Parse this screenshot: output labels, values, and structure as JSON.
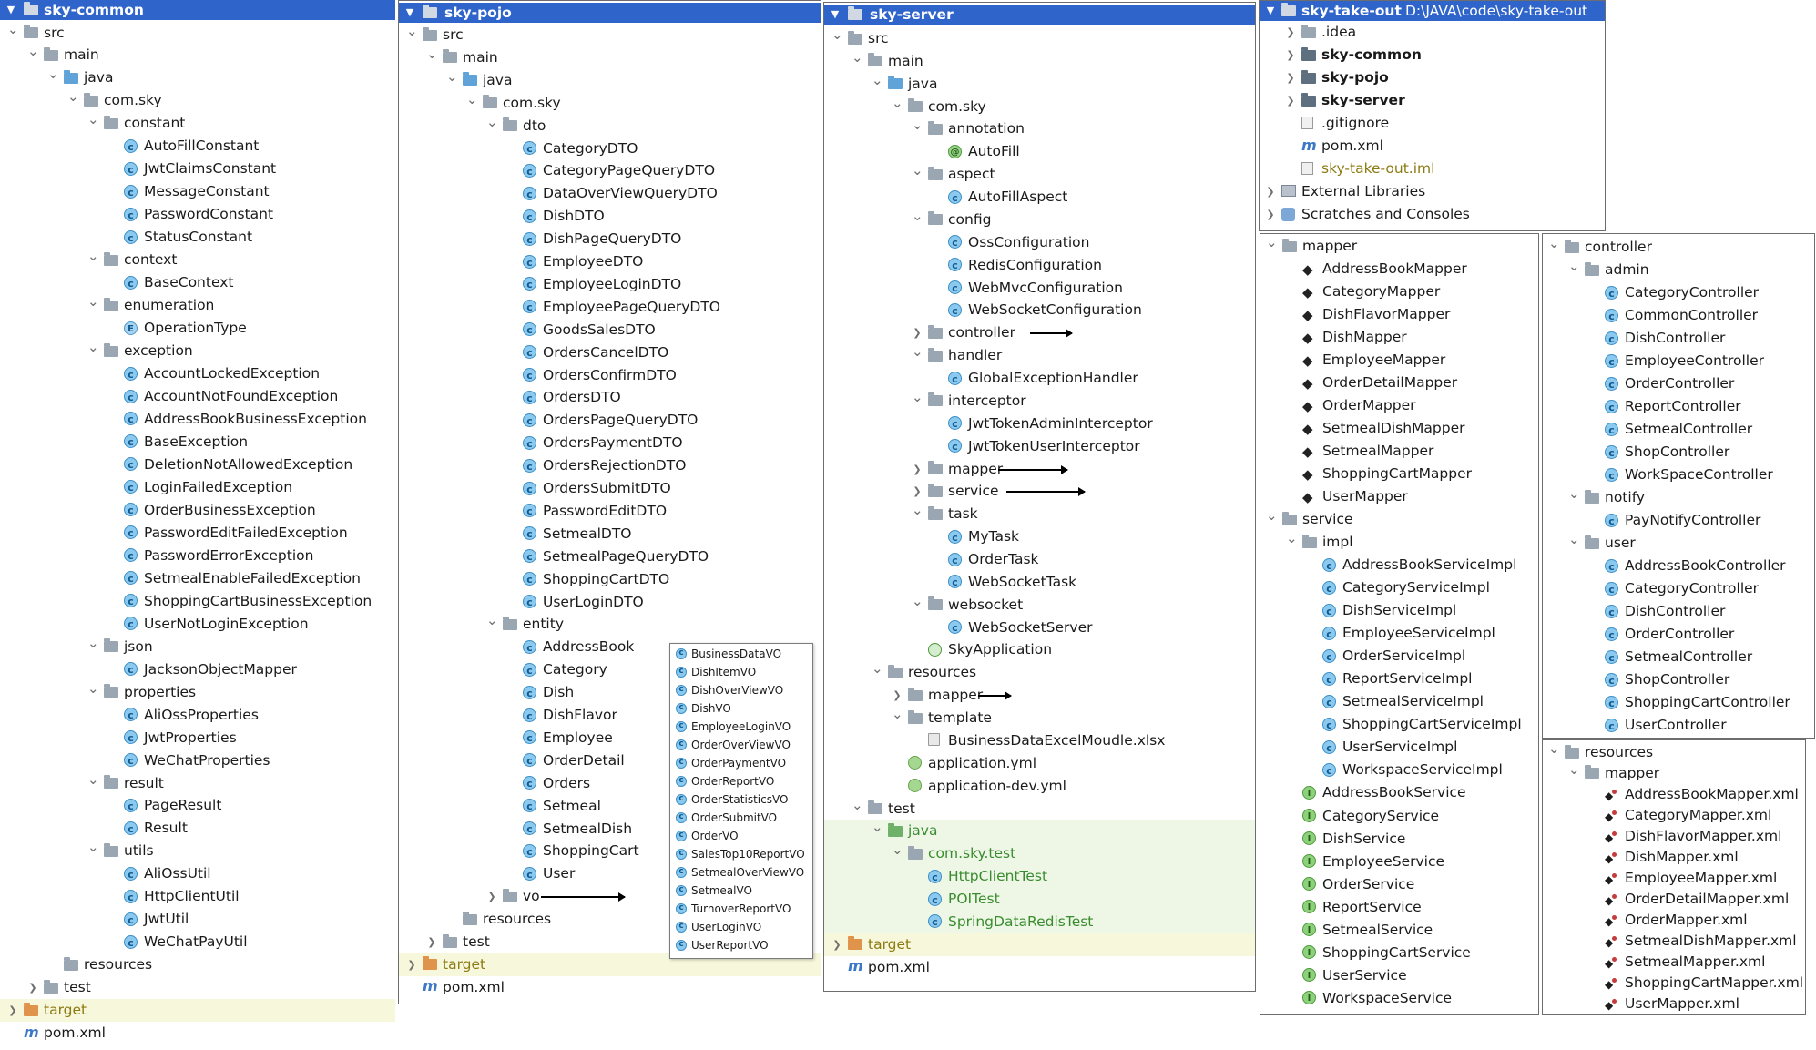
{
  "colors": {
    "header_bg": "#2f65ca",
    "class_icon": "#8cc9ef",
    "interface_icon": "#8ed17d",
    "target_highlight": "#f7f7db",
    "test_highlight": "#eef6e6"
  },
  "common": {
    "title": "sky-common",
    "rows": [
      {
        "d": 0,
        "t": "fld",
        "n": "src",
        "o": true
      },
      {
        "d": 1,
        "t": "fld",
        "n": "main",
        "o": true
      },
      {
        "d": 2,
        "t": "fld blue",
        "n": "java",
        "o": true
      },
      {
        "d": 3,
        "t": "fld",
        "n": "com.sky",
        "o": true
      },
      {
        "d": 4,
        "t": "fld",
        "n": "constant",
        "o": true
      },
      {
        "d": 5,
        "t": "cls",
        "n": "AutoFillConstant"
      },
      {
        "d": 5,
        "t": "cls",
        "n": "JwtClaimsConstant"
      },
      {
        "d": 5,
        "t": "cls",
        "n": "MessageConstant"
      },
      {
        "d": 5,
        "t": "cls",
        "n": "PasswordConstant"
      },
      {
        "d": 5,
        "t": "cls",
        "n": "StatusConstant"
      },
      {
        "d": 4,
        "t": "fld",
        "n": "context",
        "o": true
      },
      {
        "d": 5,
        "t": "cls",
        "n": "BaseContext"
      },
      {
        "d": 4,
        "t": "fld",
        "n": "enumeration",
        "o": true
      },
      {
        "d": 5,
        "t": "enm",
        "n": "OperationType"
      },
      {
        "d": 4,
        "t": "fld",
        "n": "exception",
        "o": true
      },
      {
        "d": 5,
        "t": "cls",
        "n": "AccountLockedException"
      },
      {
        "d": 5,
        "t": "cls",
        "n": "AccountNotFoundException"
      },
      {
        "d": 5,
        "t": "cls",
        "n": "AddressBookBusinessException"
      },
      {
        "d": 5,
        "t": "cls",
        "n": "BaseException"
      },
      {
        "d": 5,
        "t": "cls",
        "n": "DeletionNotAllowedException"
      },
      {
        "d": 5,
        "t": "cls",
        "n": "LoginFailedException"
      },
      {
        "d": 5,
        "t": "cls",
        "n": "OrderBusinessException"
      },
      {
        "d": 5,
        "t": "cls",
        "n": "PasswordEditFailedException"
      },
      {
        "d": 5,
        "t": "cls",
        "n": "PasswordErrorException"
      },
      {
        "d": 5,
        "t": "cls",
        "n": "SetmealEnableFailedException"
      },
      {
        "d": 5,
        "t": "cls",
        "n": "ShoppingCartBusinessException"
      },
      {
        "d": 5,
        "t": "cls",
        "n": "UserNotLoginException"
      },
      {
        "d": 4,
        "t": "fld",
        "n": "json",
        "o": true
      },
      {
        "d": 5,
        "t": "cls",
        "n": "JacksonObjectMapper"
      },
      {
        "d": 4,
        "t": "fld",
        "n": "properties",
        "o": true
      },
      {
        "d": 5,
        "t": "cls",
        "n": "AliOssProperties"
      },
      {
        "d": 5,
        "t": "cls",
        "n": "JwtProperties"
      },
      {
        "d": 5,
        "t": "cls",
        "n": "WeChatProperties"
      },
      {
        "d": 4,
        "t": "fld",
        "n": "result",
        "o": true
      },
      {
        "d": 5,
        "t": "cls",
        "n": "PageResult"
      },
      {
        "d": 5,
        "t": "cls",
        "n": "Result"
      },
      {
        "d": 4,
        "t": "fld",
        "n": "utils",
        "o": true
      },
      {
        "d": 5,
        "t": "cls",
        "n": "AliOssUtil"
      },
      {
        "d": 5,
        "t": "cls",
        "n": "HttpClientUtil"
      },
      {
        "d": 5,
        "t": "cls",
        "n": "JwtUtil"
      },
      {
        "d": 5,
        "t": "cls",
        "n": "WeChatPayUtil"
      },
      {
        "d": 2,
        "t": "fld",
        "n": "resources"
      },
      {
        "d": 1,
        "t": "fld",
        "n": "test",
        "o": false
      },
      {
        "d": 0,
        "t": "fld orange",
        "n": "target",
        "o": false,
        "hl": "tgt",
        "color": "olive"
      },
      {
        "d": 0,
        "t": "mvn",
        "n": "pom.xml"
      }
    ]
  },
  "pojo": {
    "title": "sky-pojo",
    "rows": [
      {
        "d": 0,
        "t": "fld",
        "n": "src",
        "o": true
      },
      {
        "d": 1,
        "t": "fld",
        "n": "main",
        "o": true
      },
      {
        "d": 2,
        "t": "fld blue",
        "n": "java",
        "o": true
      },
      {
        "d": 3,
        "t": "fld",
        "n": "com.sky",
        "o": true
      },
      {
        "d": 4,
        "t": "fld",
        "n": "dto",
        "o": true
      },
      {
        "d": 5,
        "t": "cls",
        "n": "CategoryDTO"
      },
      {
        "d": 5,
        "t": "cls",
        "n": "CategoryPageQueryDTO"
      },
      {
        "d": 5,
        "t": "cls",
        "n": "DataOverViewQueryDTO"
      },
      {
        "d": 5,
        "t": "cls",
        "n": "DishDTO"
      },
      {
        "d": 5,
        "t": "cls",
        "n": "DishPageQueryDTO"
      },
      {
        "d": 5,
        "t": "cls",
        "n": "EmployeeDTO"
      },
      {
        "d": 5,
        "t": "cls",
        "n": "EmployeeLoginDTO"
      },
      {
        "d": 5,
        "t": "cls",
        "n": "EmployeePageQueryDTO"
      },
      {
        "d": 5,
        "t": "cls",
        "n": "GoodsSalesDTO"
      },
      {
        "d": 5,
        "t": "cls",
        "n": "OrdersCancelDTO"
      },
      {
        "d": 5,
        "t": "cls",
        "n": "OrdersConfirmDTO"
      },
      {
        "d": 5,
        "t": "cls",
        "n": "OrdersDTO"
      },
      {
        "d": 5,
        "t": "cls",
        "n": "OrdersPageQueryDTO"
      },
      {
        "d": 5,
        "t": "cls",
        "n": "OrdersPaymentDTO"
      },
      {
        "d": 5,
        "t": "cls",
        "n": "OrdersRejectionDTO"
      },
      {
        "d": 5,
        "t": "cls",
        "n": "OrdersSubmitDTO"
      },
      {
        "d": 5,
        "t": "cls",
        "n": "PasswordEditDTO"
      },
      {
        "d": 5,
        "t": "cls",
        "n": "SetmealDTO"
      },
      {
        "d": 5,
        "t": "cls",
        "n": "SetmealPageQueryDTO"
      },
      {
        "d": 5,
        "t": "cls",
        "n": "ShoppingCartDTO"
      },
      {
        "d": 5,
        "t": "cls",
        "n": "UserLoginDTO"
      },
      {
        "d": 4,
        "t": "fld",
        "n": "entity",
        "o": true
      },
      {
        "d": 5,
        "t": "cls",
        "n": "AddressBook"
      },
      {
        "d": 5,
        "t": "cls",
        "n": "Category"
      },
      {
        "d": 5,
        "t": "cls",
        "n": "Dish"
      },
      {
        "d": 5,
        "t": "cls",
        "n": "DishFlavor"
      },
      {
        "d": 5,
        "t": "cls",
        "n": "Employee"
      },
      {
        "d": 5,
        "t": "cls",
        "n": "OrderDetail"
      },
      {
        "d": 5,
        "t": "cls",
        "n": "Orders"
      },
      {
        "d": 5,
        "t": "cls",
        "n": "Setmeal"
      },
      {
        "d": 5,
        "t": "cls",
        "n": "SetmealDish"
      },
      {
        "d": 5,
        "t": "cls",
        "n": "ShoppingCart"
      },
      {
        "d": 5,
        "t": "cls",
        "n": "User"
      },
      {
        "d": 4,
        "t": "fld",
        "n": "vo",
        "o": false,
        "arrow": "vo"
      },
      {
        "d": 2,
        "t": "fld",
        "n": "resources"
      },
      {
        "d": 1,
        "t": "fld",
        "n": "test",
        "o": false
      },
      {
        "d": 0,
        "t": "fld orange",
        "n": "target",
        "o": false,
        "hl": "tgt",
        "color": "olive"
      },
      {
        "d": 0,
        "t": "mvn",
        "n": "pom.xml"
      }
    ],
    "vo_list": [
      "BusinessDataVO",
      "DishItemVO",
      "DishOverViewVO",
      "DishVO",
      "EmployeeLoginVO",
      "OrderOverViewVO",
      "OrderPaymentVO",
      "OrderReportVO",
      "OrderStatisticsVO",
      "OrderSubmitVO",
      "OrderVO",
      "SalesTop10ReportVO",
      "SetmealOverViewVO",
      "SetmealVO",
      "TurnoverReportVO",
      "UserLoginVO",
      "UserReportVO"
    ]
  },
  "server": {
    "title": "sky-server",
    "rows": [
      {
        "d": 0,
        "t": "fld",
        "n": "src",
        "o": true
      },
      {
        "d": 1,
        "t": "fld",
        "n": "main",
        "o": true
      },
      {
        "d": 2,
        "t": "fld blue",
        "n": "java",
        "o": true
      },
      {
        "d": 3,
        "t": "fld",
        "n": "com.sky",
        "o": true
      },
      {
        "d": 4,
        "t": "fld",
        "n": "annotation",
        "o": true
      },
      {
        "d": 5,
        "t": "ann",
        "n": "AutoFill"
      },
      {
        "d": 4,
        "t": "fld",
        "n": "aspect",
        "o": true
      },
      {
        "d": 5,
        "t": "cls",
        "n": "AutoFillAspect"
      },
      {
        "d": 4,
        "t": "fld",
        "n": "config",
        "o": true
      },
      {
        "d": 5,
        "t": "cls",
        "n": "OssConfiguration"
      },
      {
        "d": 5,
        "t": "cls",
        "n": "RedisConfiguration"
      },
      {
        "d": 5,
        "t": "cls",
        "n": "WebMvcConfiguration"
      },
      {
        "d": 5,
        "t": "cls",
        "n": "WebSocketConfiguration"
      },
      {
        "d": 4,
        "t": "fld",
        "n": "controller",
        "o": false,
        "arrow": "controller"
      },
      {
        "d": 4,
        "t": "fld",
        "n": "handler",
        "o": true
      },
      {
        "d": 5,
        "t": "cls",
        "n": "GlobalExceptionHandler"
      },
      {
        "d": 4,
        "t": "fld",
        "n": "interceptor",
        "o": true
      },
      {
        "d": 5,
        "t": "cls",
        "n": "JwtTokenAdminInterceptor"
      },
      {
        "d": 5,
        "t": "cls",
        "n": "JwtTokenUserInterceptor"
      },
      {
        "d": 4,
        "t": "fld",
        "n": "mapper",
        "o": false,
        "arrow": "mapper"
      },
      {
        "d": 4,
        "t": "fld",
        "n": "service",
        "o": false,
        "arrow": "service"
      },
      {
        "d": 4,
        "t": "fld",
        "n": "task",
        "o": true
      },
      {
        "d": 5,
        "t": "cls",
        "n": "MyTask"
      },
      {
        "d": 5,
        "t": "cls",
        "n": "OrderTask"
      },
      {
        "d": 5,
        "t": "cls",
        "n": "WebSocketTask"
      },
      {
        "d": 4,
        "t": "fld",
        "n": "websocket",
        "o": true
      },
      {
        "d": 5,
        "t": "cls",
        "n": "WebSocketServer"
      },
      {
        "d": 4,
        "t": "spr",
        "n": "SkyApplication"
      },
      {
        "d": 2,
        "t": "fld",
        "n": "resources",
        "o": true
      },
      {
        "d": 3,
        "t": "fld",
        "n": "mapper",
        "o": false,
        "arrow": "rmapper"
      },
      {
        "d": 3,
        "t": "fld",
        "n": "template",
        "o": true
      },
      {
        "d": 4,
        "t": "xlsx",
        "n": "BusinessDataExcelMoudle.xlsx"
      },
      {
        "d": 3,
        "t": "yml",
        "n": "application.yml"
      },
      {
        "d": 3,
        "t": "yml",
        "n": "application-dev.yml"
      },
      {
        "d": 1,
        "t": "fld",
        "n": "test",
        "o": true
      },
      {
        "d": 2,
        "t": "fld green",
        "n": "java",
        "o": true,
        "hl": "tst",
        "color": "green"
      },
      {
        "d": 3,
        "t": "fld",
        "n": "com.sky.test",
        "o": true,
        "hl": "tst",
        "color": "green"
      },
      {
        "d": 4,
        "t": "cls",
        "n": "HttpClientTest",
        "hl": "tst",
        "color": "green"
      },
      {
        "d": 4,
        "t": "cls",
        "n": "POITest",
        "hl": "tst",
        "color": "green"
      },
      {
        "d": 4,
        "t": "cls",
        "n": "SpringDataRedisTest",
        "hl": "tst",
        "color": "green"
      },
      {
        "d": 0,
        "t": "fld orange",
        "n": "target",
        "o": false,
        "hl": "tgt",
        "color": "olive"
      },
      {
        "d": 0,
        "t": "mvn",
        "n": "pom.xml"
      }
    ]
  },
  "root": {
    "title": "sky-take-out",
    "path": "D:\\JAVA\\code\\sky-take-out",
    "rows": [
      {
        "d": 1,
        "t": "fld",
        "n": ".idea",
        "o": false
      },
      {
        "d": 1,
        "t": "fld mod",
        "n": "sky-common",
        "o": false,
        "b": true
      },
      {
        "d": 1,
        "t": "fld mod",
        "n": "sky-pojo",
        "o": false,
        "b": true
      },
      {
        "d": 1,
        "t": "fld mod",
        "n": "sky-server",
        "o": false,
        "b": true
      },
      {
        "d": 1,
        "t": "git",
        "n": ".gitignore"
      },
      {
        "d": 1,
        "t": "mvn",
        "n": "pom.xml"
      },
      {
        "d": 1,
        "t": "iml",
        "n": "sky-take-out.iml",
        "color": "olive"
      },
      {
        "d": 0,
        "t": "lib",
        "n": "External Libraries",
        "o": false
      },
      {
        "d": 0,
        "t": "scr",
        "n": "Scratches and Consoles",
        "o": false
      }
    ]
  },
  "mapper": {
    "rows": [
      {
        "d": 0,
        "t": "fld",
        "n": "mapper",
        "o": true
      },
      {
        "d": 1,
        "t": "bird",
        "n": "AddressBookMapper"
      },
      {
        "d": 1,
        "t": "bird",
        "n": "CategoryMapper"
      },
      {
        "d": 1,
        "t": "bird",
        "n": "DishFlavorMapper"
      },
      {
        "d": 1,
        "t": "bird",
        "n": "DishMapper"
      },
      {
        "d": 1,
        "t": "bird",
        "n": "EmployeeMapper"
      },
      {
        "d": 1,
        "t": "bird",
        "n": "OrderDetailMapper"
      },
      {
        "d": 1,
        "t": "bird",
        "n": "OrderMapper"
      },
      {
        "d": 1,
        "t": "bird",
        "n": "SetmealDishMapper"
      },
      {
        "d": 1,
        "t": "bird",
        "n": "SetmealMapper"
      },
      {
        "d": 1,
        "t": "bird",
        "n": "ShoppingCartMapper"
      },
      {
        "d": 1,
        "t": "bird",
        "n": "UserMapper"
      },
      {
        "d": 0,
        "t": "fld",
        "n": "service",
        "o": true
      },
      {
        "d": 1,
        "t": "fld",
        "n": "impl",
        "o": true
      },
      {
        "d": 2,
        "t": "cls",
        "n": "AddressBookServiceImpl"
      },
      {
        "d": 2,
        "t": "cls",
        "n": "CategoryServiceImpl"
      },
      {
        "d": 2,
        "t": "cls",
        "n": "DishServiceImpl"
      },
      {
        "d": 2,
        "t": "cls",
        "n": "EmployeeServiceImpl"
      },
      {
        "d": 2,
        "t": "cls",
        "n": "OrderServiceImpl"
      },
      {
        "d": 2,
        "t": "cls",
        "n": "ReportServiceImpl"
      },
      {
        "d": 2,
        "t": "cls",
        "n": "SetmealServiceImpl"
      },
      {
        "d": 2,
        "t": "cls",
        "n": "ShoppingCartServiceImpl"
      },
      {
        "d": 2,
        "t": "cls",
        "n": "UserServiceImpl"
      },
      {
        "d": 2,
        "t": "cls",
        "n": "WorkspaceServiceImpl"
      },
      {
        "d": 1,
        "t": "itf",
        "n": "AddressBookService"
      },
      {
        "d": 1,
        "t": "itf",
        "n": "CategoryService"
      },
      {
        "d": 1,
        "t": "itf",
        "n": "DishService"
      },
      {
        "d": 1,
        "t": "itf",
        "n": "EmployeeService"
      },
      {
        "d": 1,
        "t": "itf",
        "n": "OrderService"
      },
      {
        "d": 1,
        "t": "itf",
        "n": "ReportService"
      },
      {
        "d": 1,
        "t": "itf",
        "n": "SetmealService"
      },
      {
        "d": 1,
        "t": "itf",
        "n": "ShoppingCartService"
      },
      {
        "d": 1,
        "t": "itf",
        "n": "UserService"
      },
      {
        "d": 1,
        "t": "itf",
        "n": "WorkspaceService"
      }
    ]
  },
  "controller": {
    "rows": [
      {
        "d": 0,
        "t": "fld",
        "n": "controller",
        "o": true
      },
      {
        "d": 1,
        "t": "fld",
        "n": "admin",
        "o": true
      },
      {
        "d": 2,
        "t": "cls",
        "n": "CategoryController"
      },
      {
        "d": 2,
        "t": "cls",
        "n": "CommonController"
      },
      {
        "d": 2,
        "t": "cls",
        "n": "DishController"
      },
      {
        "d": 2,
        "t": "cls",
        "n": "EmployeeController"
      },
      {
        "d": 2,
        "t": "cls",
        "n": "OrderController"
      },
      {
        "d": 2,
        "t": "cls",
        "n": "ReportController"
      },
      {
        "d": 2,
        "t": "cls",
        "n": "SetmealController"
      },
      {
        "d": 2,
        "t": "cls",
        "n": "ShopController"
      },
      {
        "d": 2,
        "t": "cls",
        "n": "WorkSpaceController"
      },
      {
        "d": 1,
        "t": "fld",
        "n": "notify",
        "o": true
      },
      {
        "d": 2,
        "t": "cls",
        "n": "PayNotifyController"
      },
      {
        "d": 1,
        "t": "fld",
        "n": "user",
        "o": true
      },
      {
        "d": 2,
        "t": "cls",
        "n": "AddressBookController"
      },
      {
        "d": 2,
        "t": "cls",
        "n": "CategoryController"
      },
      {
        "d": 2,
        "t": "cls",
        "n": "DishController"
      },
      {
        "d": 2,
        "t": "cls",
        "n": "OrderController"
      },
      {
        "d": 2,
        "t": "cls",
        "n": "SetmealController"
      },
      {
        "d": 2,
        "t": "cls",
        "n": "ShopController"
      },
      {
        "d": 2,
        "t": "cls",
        "n": "ShoppingCartController"
      },
      {
        "d": 2,
        "t": "cls",
        "n": "UserController"
      }
    ]
  },
  "resources": {
    "rows": [
      {
        "d": 0,
        "t": "fld",
        "n": "resources",
        "o": true
      },
      {
        "d": 1,
        "t": "fld",
        "n": "mapper",
        "o": true
      },
      {
        "d": 2,
        "t": "xml",
        "n": "AddressBookMapper.xml"
      },
      {
        "d": 2,
        "t": "xml",
        "n": "CategoryMapper.xml"
      },
      {
        "d": 2,
        "t": "xml",
        "n": "DishFlavorMapper.xml"
      },
      {
        "d": 2,
        "t": "xml",
        "n": "DishMapper.xml"
      },
      {
        "d": 2,
        "t": "xml",
        "n": "EmployeeMapper.xml"
      },
      {
        "d": 2,
        "t": "xml",
        "n": "OrderDetailMapper.xml"
      },
      {
        "d": 2,
        "t": "xml",
        "n": "OrderMapper.xml"
      },
      {
        "d": 2,
        "t": "xml",
        "n": "SetmealDishMapper.xml"
      },
      {
        "d": 2,
        "t": "xml",
        "n": "SetmealMapper.xml"
      },
      {
        "d": 2,
        "t": "xml",
        "n": "ShoppingCartMapper.xml"
      },
      {
        "d": 2,
        "t": "xml",
        "n": "UserMapper.xml"
      }
    ]
  }
}
